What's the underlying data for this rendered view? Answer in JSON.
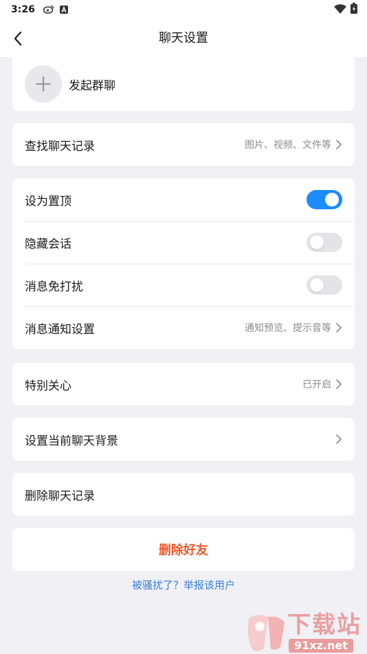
{
  "status_bar": {
    "time": "3:26",
    "left_icons": [
      "weibo-icon",
      "notification-a-icon"
    ],
    "right_icons": [
      "wifi-icon",
      "battery-icon"
    ]
  },
  "nav": {
    "title": "聊天设置",
    "back_icon": "chevron-left-icon"
  },
  "group_chat": {
    "label": "发起群聊",
    "icon": "plus-icon"
  },
  "search_history": {
    "label": "查找聊天记录",
    "hint": "图片、视频、文件等"
  },
  "settings": {
    "pin": {
      "label": "设为置顶",
      "enabled": true
    },
    "hide": {
      "label": "隐藏会话",
      "enabled": false
    },
    "mute": {
      "label": "消息免打扰",
      "enabled": false
    },
    "notify": {
      "label": "消息通知设置",
      "hint": "通知预览、提示音等"
    }
  },
  "special_care": {
    "label": "特别关心",
    "hint": "已开启"
  },
  "background": {
    "label": "设置当前聊天背景"
  },
  "delete_history": {
    "label": "删除聊天记录"
  },
  "delete_friend": {
    "label": "删除好友"
  },
  "report": {
    "label": "被骚扰了？举报该用户"
  },
  "watermark": {
    "text": "下载站",
    "url_text": "91xz.net"
  },
  "colors": {
    "accent": "#1a8cff",
    "danger": "#f0582c",
    "link": "#3a7fd4",
    "background": "#f0f0f5"
  }
}
